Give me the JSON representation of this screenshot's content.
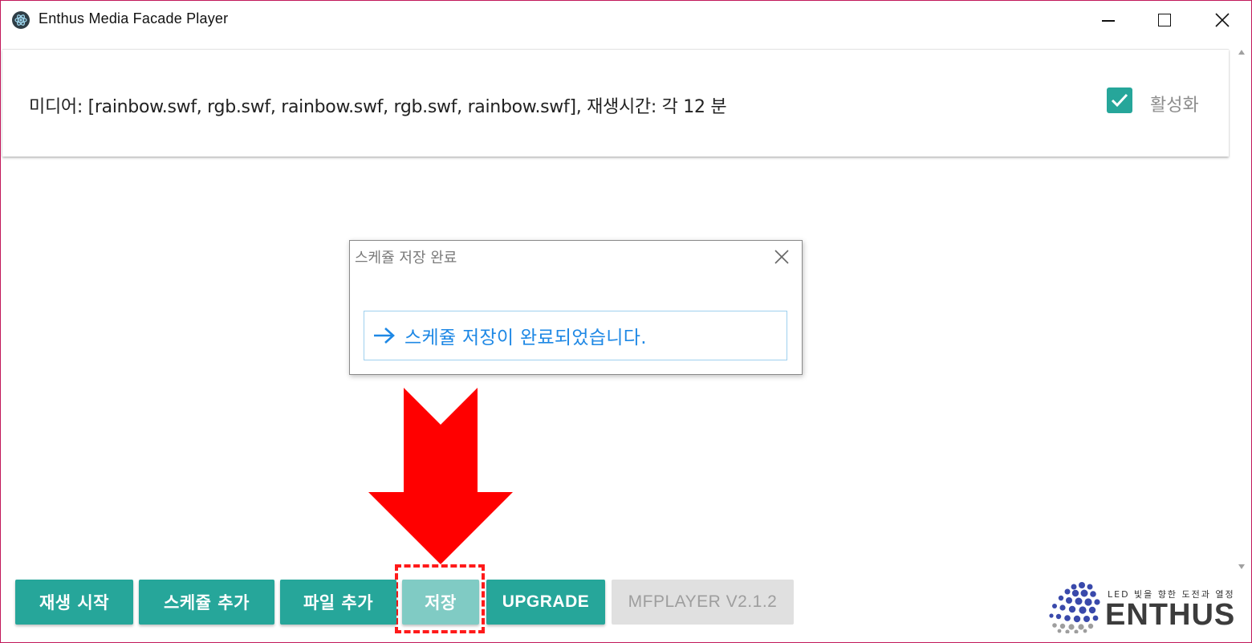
{
  "window": {
    "title": "Enthus Media Facade Player",
    "border_color": "#c2185b"
  },
  "card": {
    "media_text": "미디어: [rainbow.swf, rgb.swf, rainbow.swf, rgb.swf, rainbow.swf], 재생시간: 각 12 분",
    "enabled_label": "활성화",
    "enabled_checked": true
  },
  "dialog": {
    "title": "스케쥴 저장 완료",
    "message": "스케쥴 저장이 완료되었습니다."
  },
  "buttons": {
    "play": "재생 시작",
    "add_schedule": "스케쥴 추가",
    "add_file": "파일 추가",
    "save": "저장",
    "upgrade": "UPGRADE",
    "version": "MFPLAYER V2.1.2"
  },
  "logo": {
    "tagline": "LED 빛을 향한 도전과 열정",
    "word": "ENTHUS"
  },
  "icons": [
    "app-icon",
    "minimize-icon",
    "maximize-icon",
    "close-icon",
    "check-icon",
    "arrow-right-icon",
    "scroll-up-icon",
    "scroll-down-icon",
    "red-down-arrow",
    "enthus-logo-icon"
  ],
  "colors": {
    "accent": "#26a69a",
    "accent_disabled": "#80cbc4",
    "dialog_text": "#1e88e5",
    "annotation_red": "#ff1a1a"
  }
}
